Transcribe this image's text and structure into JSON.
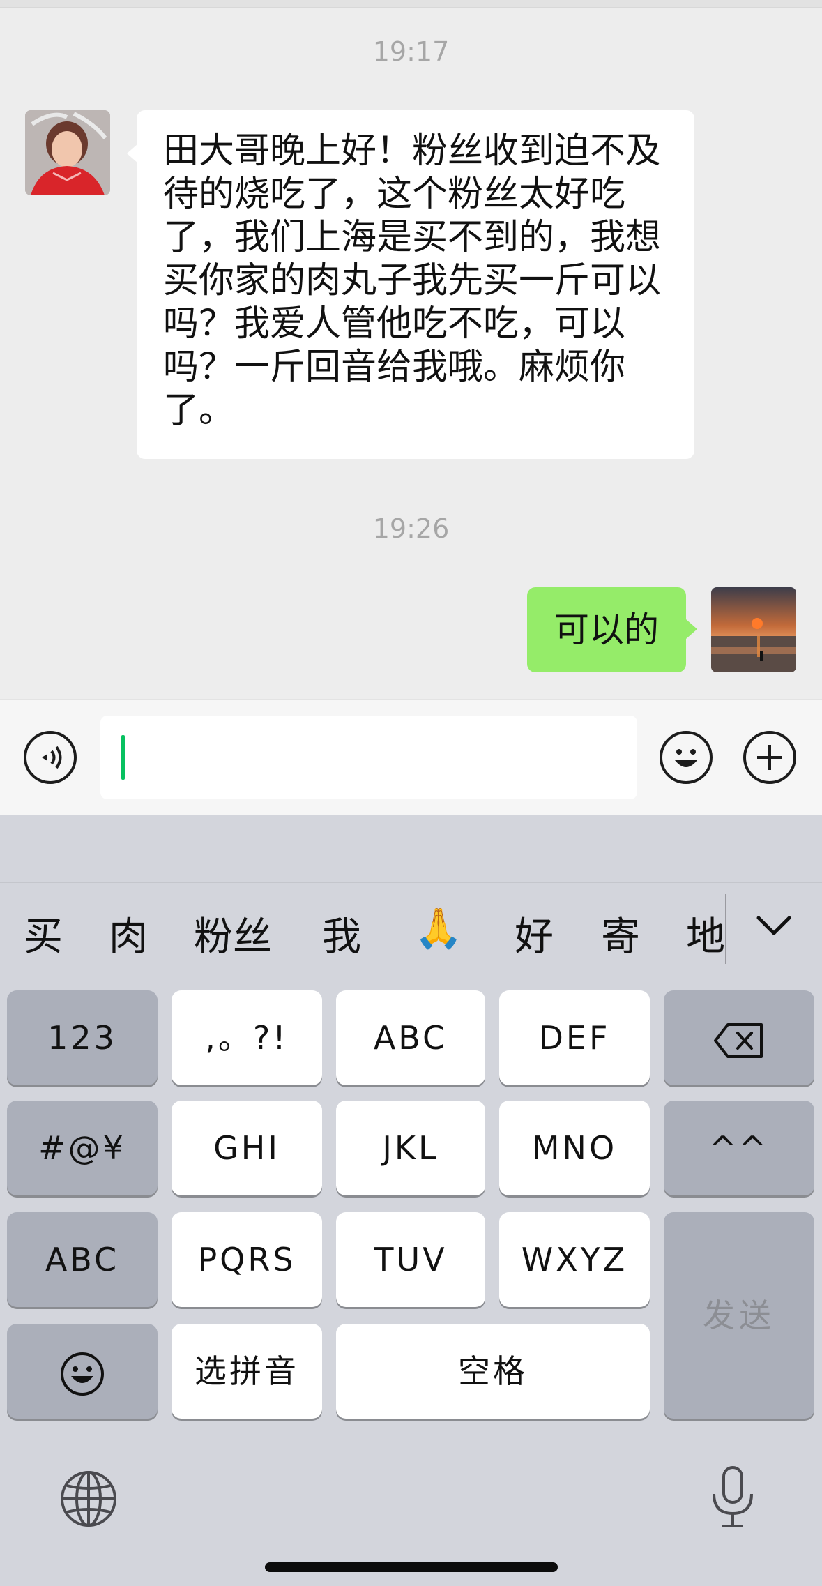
{
  "chat": {
    "timestamps": [
      "19:17",
      "19:26"
    ],
    "incoming_message": "田大哥晚上好！粉丝收到迫不及\n待的烧吃了，这个粉丝太好吃\n了，我们上海是买不到的，我想\n买你家的肉丸子我先买一斤可以\n吗？我爱人管他吃不吃，可以\n吗？一斤回音给我哦。麻烦你\n了。",
    "outgoing_message": "可以的"
  },
  "input_bar": {
    "voice_icon": "voice-icon",
    "emoji_icon": "emoji-icon",
    "plus_icon": "plus-icon",
    "text_value": ""
  },
  "keyboard": {
    "suggestions": [
      "买",
      "肉",
      "粉丝",
      "我",
      "🙏",
      "好",
      "寄",
      "地"
    ],
    "collapse_icon": "chevron-down-icon",
    "rows": [
      [
        "123",
        ",。?!",
        "ABC",
        "DEF",
        "backspace-icon"
      ],
      [
        "#@¥",
        "GHI",
        "JKL",
        "MNO",
        "^^"
      ],
      [
        "ABC",
        "PQRS",
        "TUV",
        "WXYZ"
      ],
      [
        "emoji-icon",
        "选拼音",
        "空格"
      ]
    ],
    "send_label": "发送",
    "globe_icon": "globe-icon",
    "mic_icon": "microphone-icon"
  },
  "colors": {
    "background": "#ededed",
    "outgoing_bubble": "#95ec69",
    "incoming_bubble": "#ffffff",
    "caret": "#07c160",
    "keyboard_bg": "#d3d5dc",
    "function_key": "#abafba"
  }
}
